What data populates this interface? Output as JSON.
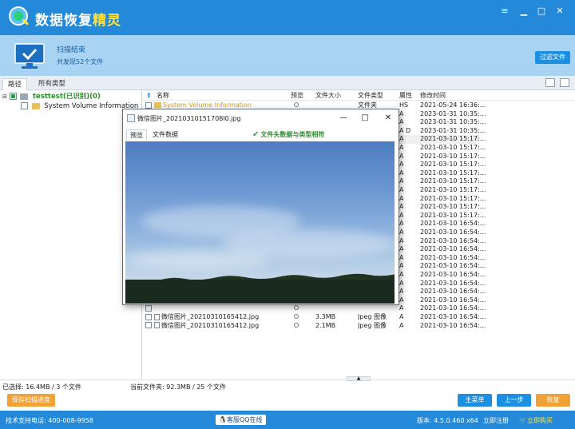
{
  "app": {
    "title_part1": "数据恢复",
    "title_part2": "精灵",
    "minimize": "▁",
    "menu": "≡",
    "maximize": "□",
    "close": "✕"
  },
  "status": {
    "title": "扫描结束",
    "subtitle": "共发现52个文件",
    "filter_button": "过滤文件"
  },
  "tabs": [
    "路径",
    "所有类型"
  ],
  "tree": {
    "root_label": "testtest(已识别)(0)",
    "child_label": "System Volume Information"
  },
  "table": {
    "headers": {
      "name": "名称",
      "preview": "预览",
      "size": "文件大小",
      "type": "文件类型",
      "attr": "属性",
      "mtime": "修改时间"
    },
    "rows": [
      {
        "name": "System Volume Information",
        "size": "",
        "type": "文件夹",
        "attr": "HS",
        "mtime": "2021-05-24 16:36:..."
      },
      {
        "name": "",
        "size": "",
        "type": "",
        "attr": "A",
        "mtime": "2023-01-31 10:35:..."
      },
      {
        "name": "",
        "size": "",
        "type": "",
        "attr": "A",
        "mtime": "2023-01-31 10:35:..."
      },
      {
        "name": "",
        "size": "",
        "type": "",
        "attr": "A D",
        "mtime": "2023-01-31 10:35:..."
      },
      {
        "name": "",
        "size": "",
        "type": "",
        "attr": "A",
        "mtime": "2021-03-10 15:17:..."
      },
      {
        "name": "",
        "size": "",
        "type": "",
        "attr": "A",
        "mtime": "2021-03-10 15:17:..."
      },
      {
        "name": "",
        "size": "",
        "type": "",
        "attr": "A",
        "mtime": "2021-03-10 15:17:..."
      },
      {
        "name": "",
        "size": "",
        "type": "",
        "attr": "A",
        "mtime": "2021-03-10 15:17:..."
      },
      {
        "name": "",
        "size": "",
        "type": "",
        "attr": "A",
        "mtime": "2021-03-10 15:17:..."
      },
      {
        "name": "",
        "size": "",
        "type": "",
        "attr": "A",
        "mtime": "2021-03-10 15:17:..."
      },
      {
        "name": "",
        "size": "",
        "type": "",
        "attr": "A",
        "mtime": "2021-03-10 15:17:..."
      },
      {
        "name": "",
        "size": "",
        "type": "",
        "attr": "A",
        "mtime": "2021-03-10 15:17:..."
      },
      {
        "name": "",
        "size": "",
        "type": "",
        "attr": "A",
        "mtime": "2021-03-10 15:17:..."
      },
      {
        "name": "",
        "size": "",
        "type": "",
        "attr": "A",
        "mtime": "2021-03-10 15:17:..."
      },
      {
        "name": "",
        "size": "",
        "type": "",
        "attr": "A",
        "mtime": "2021-03-10 16:54:..."
      },
      {
        "name": "",
        "size": "",
        "type": "",
        "attr": "A",
        "mtime": "2021-03-10 16:54:..."
      },
      {
        "name": "",
        "size": "",
        "type": "",
        "attr": "A",
        "mtime": "2021-03-10 16:54:..."
      },
      {
        "name": "",
        "size": "",
        "type": "",
        "attr": "A",
        "mtime": "2021-03-10 16:54:..."
      },
      {
        "name": "",
        "size": "",
        "type": "",
        "attr": "A",
        "mtime": "2021-03-10 16:54:..."
      },
      {
        "name": "",
        "size": "",
        "type": "",
        "attr": "A",
        "mtime": "2021-03-10 16:54:..."
      },
      {
        "name": "",
        "size": "",
        "type": "",
        "attr": "A",
        "mtime": "2021-03-10 16:54:..."
      },
      {
        "name": "",
        "size": "",
        "type": "",
        "attr": "A",
        "mtime": "2021-03-10 16:54:..."
      },
      {
        "name": "",
        "size": "",
        "type": "",
        "attr": "A",
        "mtime": "2021-03-10 16:54:..."
      },
      {
        "name": "",
        "size": "",
        "type": "",
        "attr": "A",
        "mtime": "2021-03-10 16:54:..."
      },
      {
        "name": "",
        "size": "",
        "type": "",
        "attr": "A",
        "mtime": "2021-03-10 16:54:..."
      },
      {
        "name": "微信图片_20210310165412.jpg",
        "size": "3.3MB",
        "type": "Jpeg 图像",
        "attr": "A",
        "mtime": "2021-03-10 16:54:..."
      },
      {
        "name": "微信图片_20210310165412.jpg",
        "size": "2.1MB",
        "type": "Jpeg 图像",
        "attr": "A",
        "mtime": "2021-03-10 16:54:..."
      }
    ]
  },
  "preview_window": {
    "filename": "微信图片_20210310151708I0.jpg",
    "minimize": "—",
    "maximize": "□",
    "close": "✕",
    "tab_preview": "预览",
    "tab_data": "文件数据",
    "check_text": "文件头数据与类型相符",
    "check_icon": "✔"
  },
  "bottom": {
    "selected": "已选择: 16.4MB / 3 个文件",
    "current_folder": "当前文件夹: 92.3MB / 25 个文件",
    "save_progress": "保存扫描进度",
    "main_menu": "主菜单",
    "prev_step": "上一步",
    "recover": "恢复",
    "collapse_glyph": "▲"
  },
  "footer": {
    "phone": "技术支持电话: 400-008-9958",
    "qq": "客服QQ在线",
    "version": "版本: 4.5.0.460 x64",
    "register": "立即注册",
    "buy": "立即购买"
  },
  "colors": {
    "brand_blue": "#2489d9",
    "band_blue": "#a9d3f2",
    "button_blue": "#1d8fe0",
    "button_orange": "#f0a236",
    "accent_yellow": "#ffe33c",
    "check_green": "#2ea043"
  }
}
